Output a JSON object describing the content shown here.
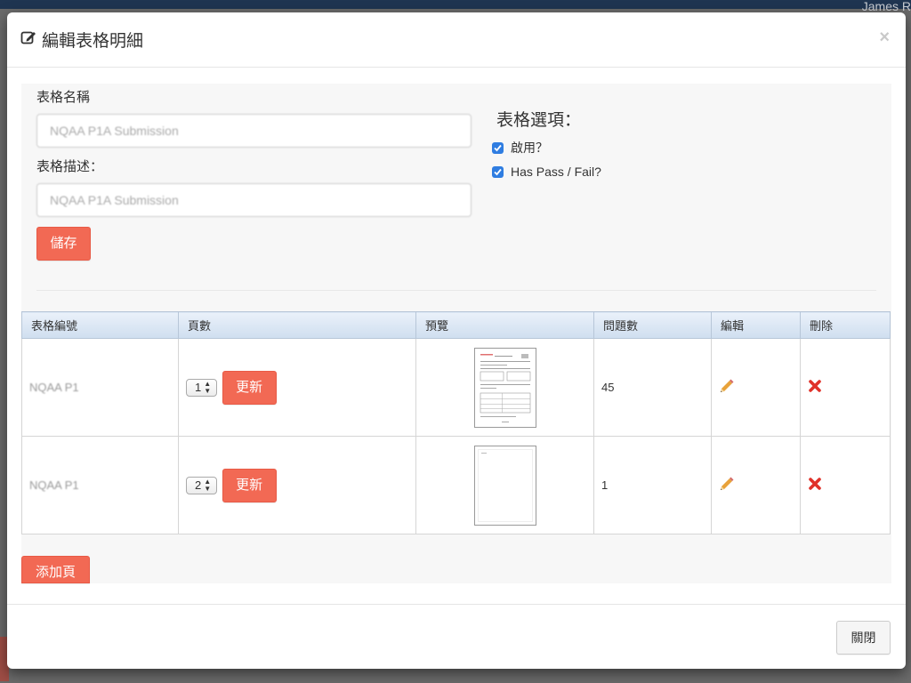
{
  "background": {
    "user_name": "James R"
  },
  "modal": {
    "title": "編輯表格明細",
    "close_symbol": "×",
    "close_button": "關閉"
  },
  "form": {
    "name_label": "表格名稱",
    "name_value": "NQAA P1A Submission",
    "desc_label": "表格描述：",
    "desc_value": "NQAA P1A Submission",
    "save_button": "儲存",
    "options_title": "表格選項：",
    "options": [
      {
        "label": "啟用？",
        "checked": true
      },
      {
        "label": "Has Pass / Fail?",
        "checked": true
      }
    ]
  },
  "table": {
    "headers": [
      "表格編號",
      "頁數",
      "預覽",
      "問題數",
      "編輯",
      "刪除"
    ],
    "rows": [
      {
        "code": "NQAA P1",
        "page": "1",
        "update": "更新",
        "questions": "45",
        "preview": "form-page"
      },
      {
        "code": "NQAA P1",
        "page": "2",
        "update": "更新",
        "questions": "1",
        "preview": "blank-page"
      }
    ]
  },
  "add_page_button": "添加頁",
  "colors": {
    "accent": "#f26954",
    "checkbox": "#2f7de1",
    "delete": "#e0322a"
  }
}
